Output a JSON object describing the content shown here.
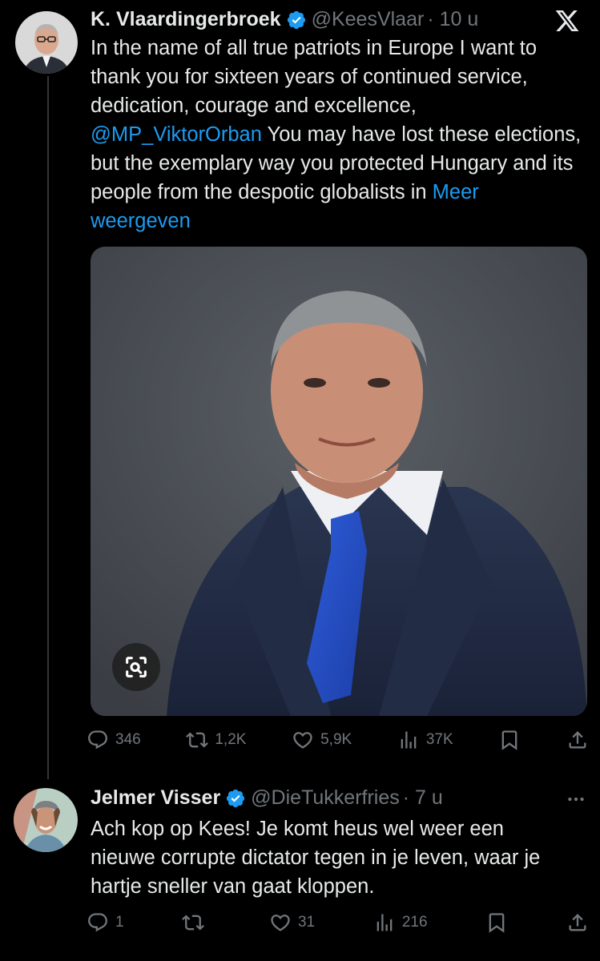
{
  "tweet": {
    "author_name": "K. Vlaardingerbroek",
    "author_handle": "@KeesVlaar",
    "time": "· 10 u",
    "text_before_mention": "In the name of all true patriots in Europe I want to thank you for sixteen years of continued service, dedication, courage and excellence,",
    "mention": "@MP_ViktorOrban",
    "text_after_mention": " You may have lost these elections, but the exemplary way you protected Hungary and its people from the despotic globalists in ",
    "show_more": "Meer weergeven",
    "replies": "346",
    "reposts": "1,2K",
    "likes": "5,9K",
    "views": "37K"
  },
  "reply": {
    "author_name": "Jelmer Visser",
    "author_handle": "@DieTukkerfries",
    "time": "· 7 u",
    "text": "Ach kop op Kees! Je komt heus wel weer een nieuwe corrupte dictator tegen in je leven, waar je hartje sneller van gaat kloppen.",
    "replies": "1",
    "reposts": "",
    "likes": "31",
    "views": "216"
  },
  "icons": {
    "close": "x-logo-icon",
    "verified": "verified-badge-icon",
    "reply": "reply-icon",
    "repost": "repost-icon",
    "like": "heart-icon",
    "views": "views-icon",
    "bookmark": "bookmark-icon",
    "share": "share-icon",
    "lens": "visual-search-icon",
    "more": "more-icon"
  },
  "colors": {
    "background": "#000000",
    "text": "#e7e9ea",
    "secondary": "#71767b",
    "link": "#1d9bf0",
    "verified": "#1d9bf0"
  }
}
